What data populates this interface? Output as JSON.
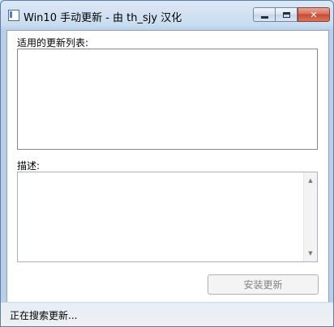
{
  "window": {
    "title": "Win10 手动更新 - 由 th_sjy 汉化",
    "icon": "app-icon",
    "controls": {
      "minimize": "minimize-icon",
      "maximize": "maximize-icon",
      "close": "close-icon",
      "close_glyph": "✕"
    }
  },
  "updates": {
    "label": "适用的更新列表:",
    "items": []
  },
  "description": {
    "label": "描述:",
    "text": "",
    "scroll_up_glyph": "▲",
    "scroll_down_glyph": "▼"
  },
  "actions": {
    "install_label": "安装更新",
    "install_enabled": false
  },
  "status": {
    "text": "正在搜索更新..."
  },
  "colors": {
    "titlebar": "#c9dcf0",
    "close_button": "#c74a30",
    "disabled_text": "#838383"
  }
}
